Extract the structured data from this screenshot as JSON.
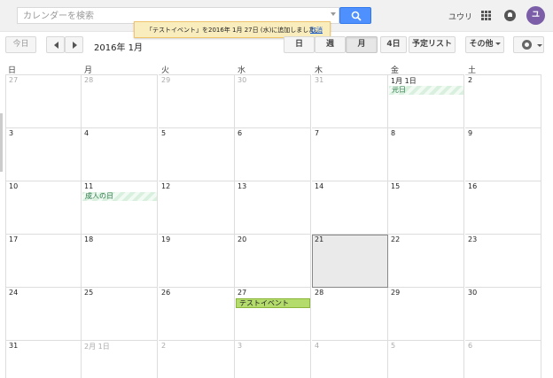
{
  "search": {
    "placeholder": "カレンダーを検索"
  },
  "header": {
    "user_name": "ユウリ",
    "avatar_initial": "ユ"
  },
  "toast": {
    "message": "「テストイベント」を2016年 1月 27日 (水)に追加しました。",
    "undo_label": "取消"
  },
  "toolbar": {
    "today": "今日",
    "date_title": "2016年 1月",
    "views": [
      "日",
      "週",
      "月",
      "4日",
      "予定リスト"
    ],
    "active_view": "月",
    "more": "その他"
  },
  "weekdays": [
    "日",
    "月",
    "火",
    "水",
    "木",
    "金",
    "土"
  ],
  "weeks": [
    [
      "27",
      "28",
      "29",
      "30",
      "31",
      "1月 1日",
      "2"
    ],
    [
      "3",
      "4",
      "5",
      "6",
      "7",
      "8",
      "9"
    ],
    [
      "10",
      "11",
      "12",
      "13",
      "14",
      "15",
      "16"
    ],
    [
      "17",
      "18",
      "19",
      "20",
      "21",
      "22",
      "23"
    ],
    [
      "24",
      "25",
      "26",
      "27",
      "28",
      "29",
      "30"
    ],
    [
      "31",
      "2月 1日",
      "2",
      "3",
      "4",
      "5",
      "6"
    ]
  ],
  "holidays": {
    "new_year": "元日",
    "coming_of_age": "成人の日"
  },
  "events": {
    "test_event": "テストイベント"
  },
  "colors": {
    "accent": "#4d90fe",
    "event": "#b3dc6c",
    "holiday_text": "#2b7a48",
    "toast_bg": "#f9edbe"
  }
}
